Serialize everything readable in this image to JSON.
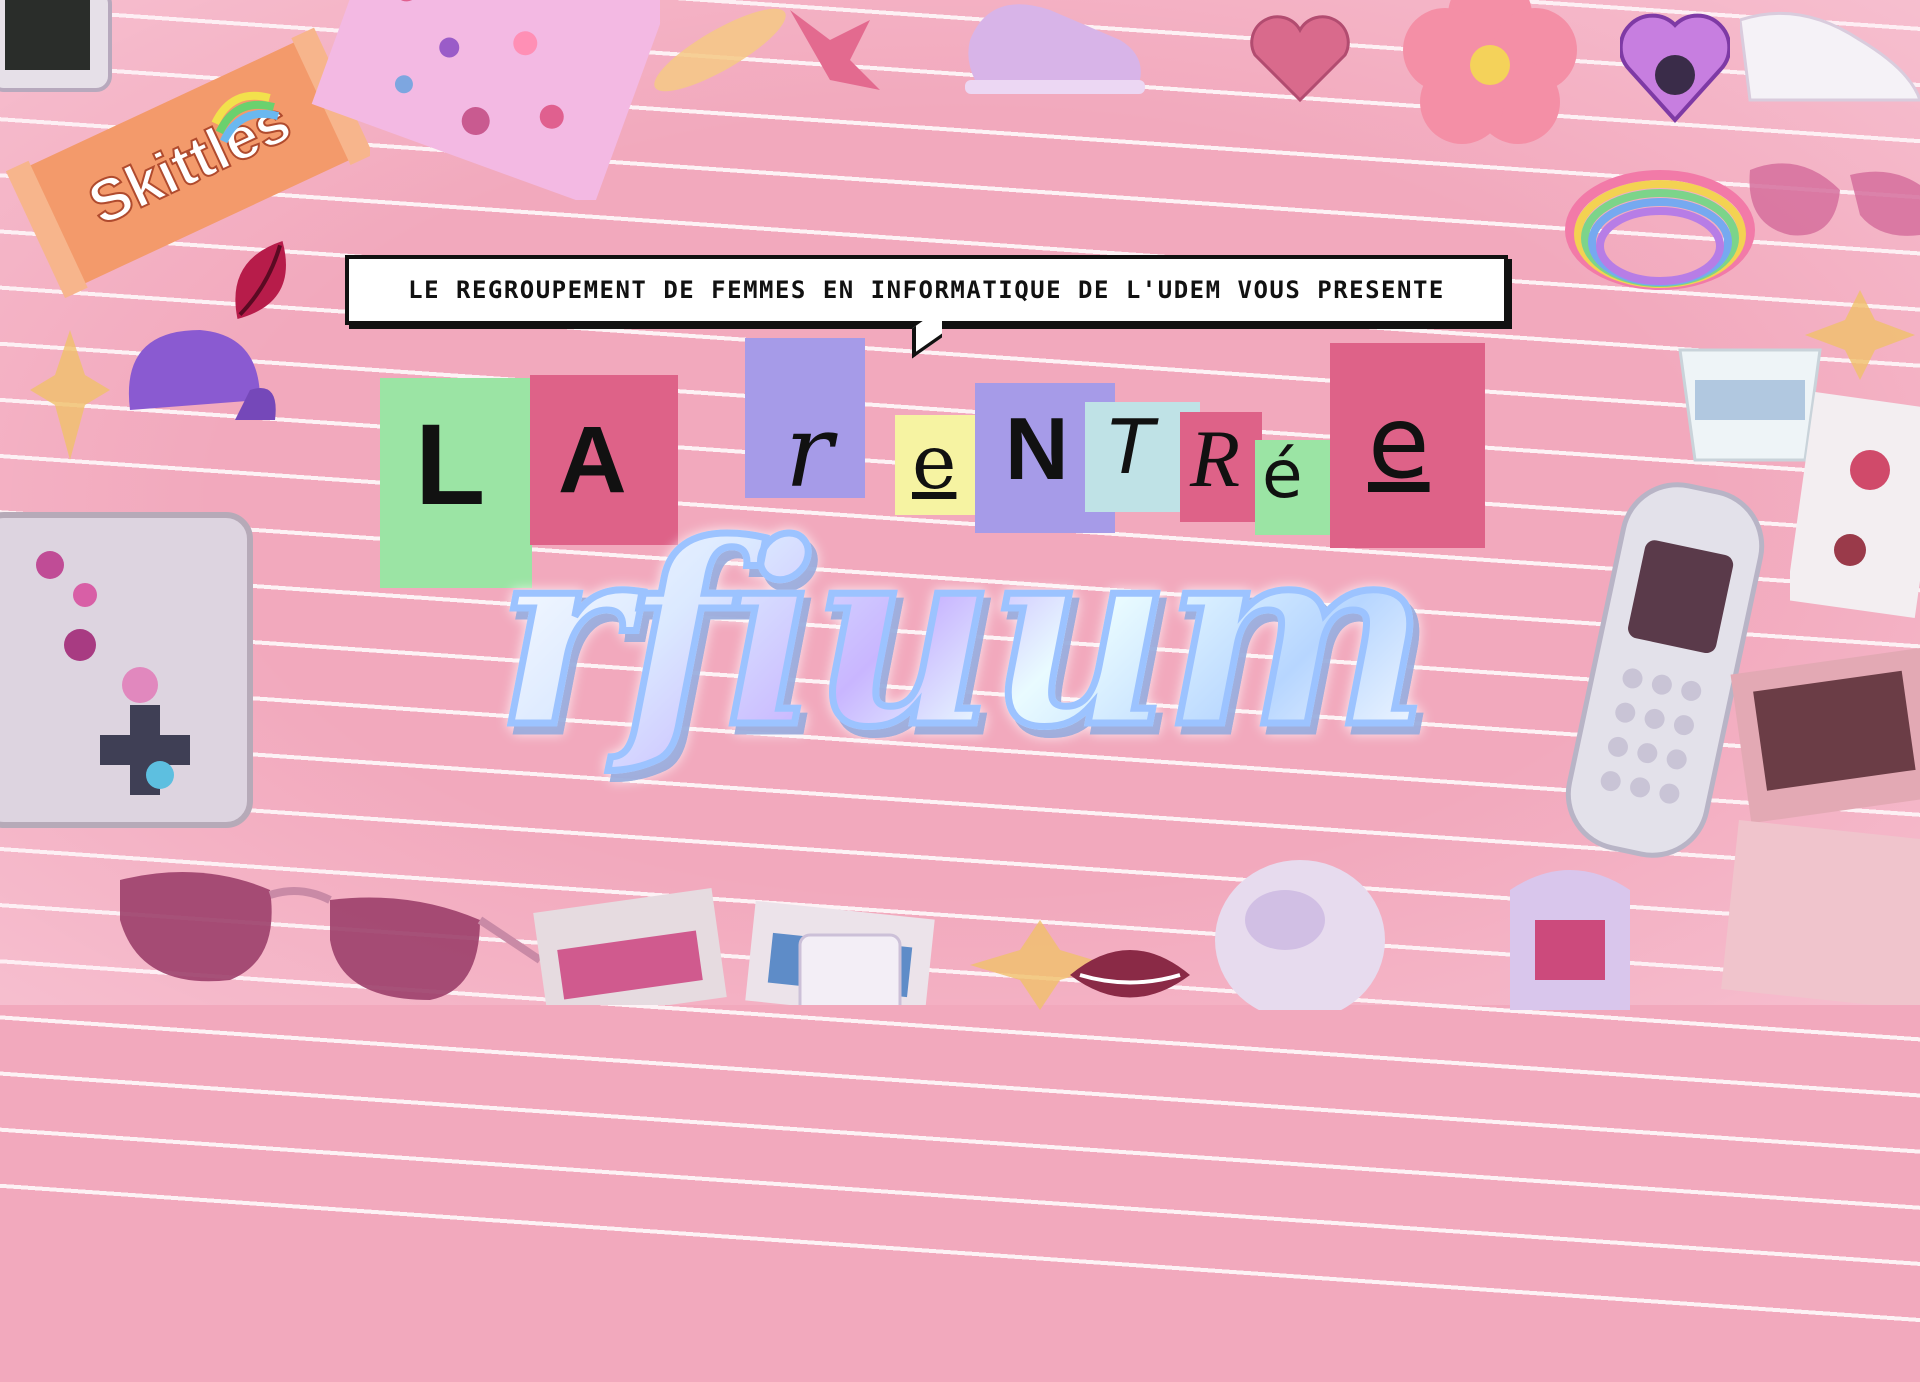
{
  "subtitle": "LE REGROUPEMENT DE FEMMES EN INFORMATIQUE DE L'UDEM VOUS PRESENTE",
  "title_letters": [
    "L",
    "A",
    "r",
    "e",
    "N",
    "T",
    "R",
    "é",
    "e"
  ],
  "script_title": "rfiuum",
  "skittles_label": "Skittles",
  "colors": {
    "background": "#f2a9bd",
    "green_tile": "#9be4a4",
    "pink_tile": "#de6288",
    "lavender_tile": "#a69be8",
    "yellow_tile": "#f6f3a2",
    "blue_tile": "#bfe2e6",
    "script_outline": "#9cc3ff"
  },
  "icons": [
    "candy-wrapper-icon",
    "sticker-sheet-icon",
    "sneaker-icon",
    "heart-icon",
    "flower-icon",
    "sunglasses-icon",
    "lips-icon",
    "cap-icon",
    "bracelet-icon",
    "phone-icon",
    "tub-icon",
    "markers-icon"
  ]
}
